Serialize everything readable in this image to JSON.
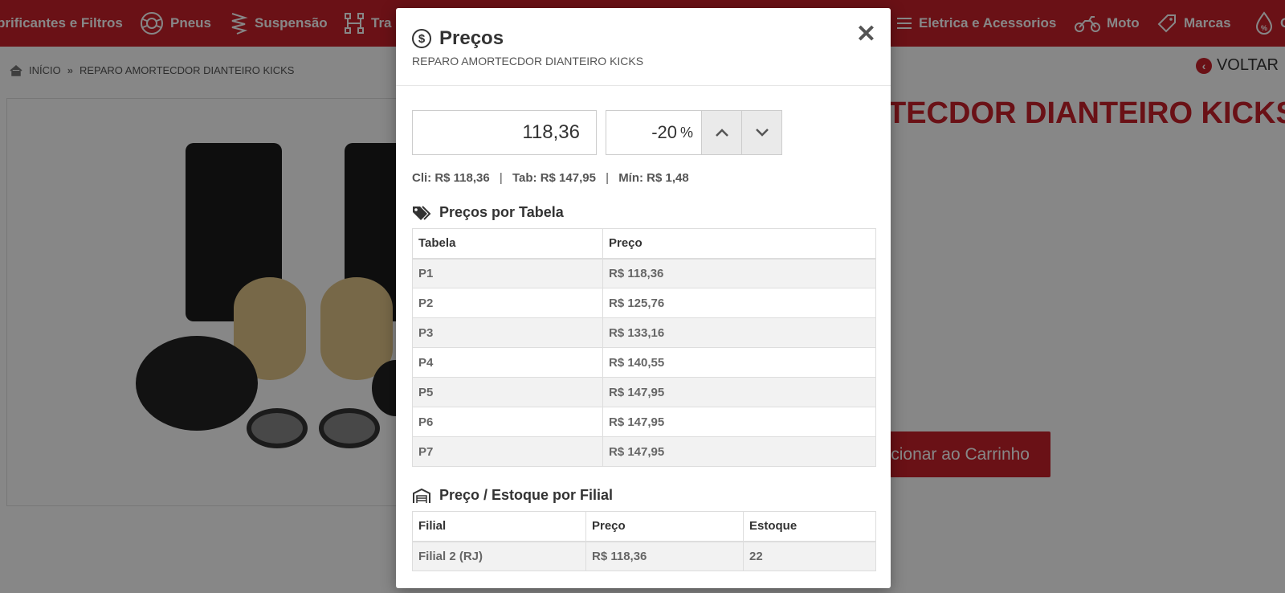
{
  "nav": {
    "items": [
      {
        "label": "brificantes e Filtros",
        "icon": "oil-filter-icon"
      },
      {
        "label": "Pneus",
        "icon": "tire-icon"
      },
      {
        "label": "Suspensão",
        "icon": "spring-icon"
      },
      {
        "label": "Tra",
        "icon": "transmission-icon"
      },
      {
        "label": "Eletrica e Acessorios",
        "icon": "menu-lines-icon"
      },
      {
        "label": "Moto",
        "icon": "motorcycle-icon"
      },
      {
        "label": "Marcas",
        "icon": "tag-icon"
      },
      {
        "label": "O",
        "icon": "percent-drop-icon"
      }
    ]
  },
  "breadcrumb": {
    "home": "INÍCIO",
    "current": "REPARO AMORTECDOR DIANTEIRO KICKS"
  },
  "back_label": "VOLTAR",
  "product": {
    "title_visible": "TECDOR DIANTEIRO KICKS",
    "cart_button": "icionar ao Carrinho"
  },
  "modal": {
    "title": "Preços",
    "subtitle": "REPARO AMORTECDOR DIANTEIRO KICKS",
    "close": "✕",
    "price_value": "118,36",
    "discount_value": "-20",
    "discount_unit": "%",
    "summary": {
      "cli": "Cli: R$ 118,36",
      "tab": "Tab: R$ 147,95",
      "min": "Mín: R$ 1,48",
      "divider": "|"
    },
    "tables_section": {
      "title": "Preços por Tabela",
      "headers": [
        "Tabela",
        "Preço"
      ],
      "rows": [
        [
          "P1",
          "R$ 118,36"
        ],
        [
          "P2",
          "R$ 125,76"
        ],
        [
          "P3",
          "R$ 133,16"
        ],
        [
          "P4",
          "R$ 140,55"
        ],
        [
          "P5",
          "R$ 147,95"
        ],
        [
          "P6",
          "R$ 147,95"
        ],
        [
          "P7",
          "R$ 147,95"
        ]
      ]
    },
    "branch_section": {
      "title": "Preço / Estoque por Filial",
      "headers": [
        "Filial",
        "Preço",
        "Estoque"
      ],
      "rows": [
        [
          "Filial 2 (RJ)",
          "R$ 118,36",
          "22"
        ]
      ]
    }
  },
  "colors": {
    "brand_red": "#c8202b",
    "overlay": "rgba(0,0,0,0.47)"
  }
}
